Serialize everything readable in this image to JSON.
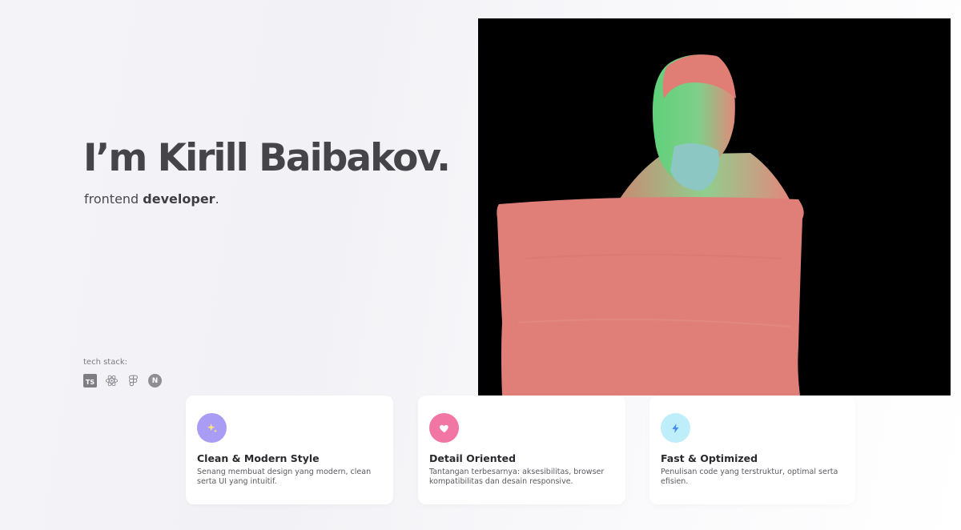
{
  "hero": {
    "name": "I’m Kirill Baibakov.",
    "role_prefix": "frontend ",
    "role_bold": "developer",
    "role_suffix": "."
  },
  "tech_stack": {
    "label": "tech stack:",
    "icons": [
      {
        "name": "typescript-icon",
        "text": "TS"
      },
      {
        "name": "react-icon"
      },
      {
        "name": "figma-icon"
      },
      {
        "name": "nextjs-icon",
        "text": "N"
      }
    ]
  },
  "features": [
    {
      "title": "Clean & Modern Style",
      "description": "Senang membuat design yang modern, clean serta UI yang intuitif.",
      "icon": "sparkles-icon",
      "color": "#a99cf5"
    },
    {
      "title": "Detail Oriented",
      "description": "Tantangan terbesarnya: aksesibilitas, browser kompatibilitas dan desain responsive.",
      "icon": "heart-icon",
      "color": "#f276a3"
    },
    {
      "title": "Fast & Optimized",
      "description": "Penulisan code yang terstruktur, optimal serta efisien.",
      "icon": "lightning-icon",
      "color": "#bdeef9"
    }
  ]
}
